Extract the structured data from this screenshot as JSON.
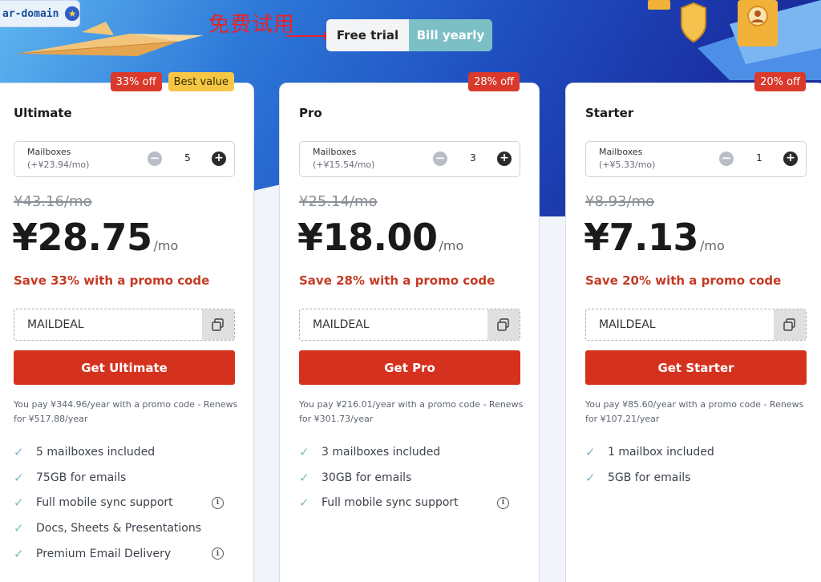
{
  "header": {
    "domain_chip_text": "ar-domain",
    "annotation_text": "免费试用",
    "toggle": {
      "free_trial_label": "Free trial",
      "bill_yearly_label": "Bill yearly"
    }
  },
  "colors": {
    "cta_red": "#d4321f",
    "save_red": "#c43a24",
    "badge_red": "#d93a2b",
    "badge_yellow": "#f6c744",
    "toggle_teal": "#7cc0c6",
    "check_teal": "#7ab8bf"
  },
  "plans": [
    {
      "name": "Ultimate",
      "badges": [
        "33% off",
        "Best value"
      ],
      "mailboxes_label": "Mailboxes",
      "mailbox_price": "(+¥23.94/mo)",
      "quantity": "5",
      "old_price": "¥43.16/mo",
      "price": "¥28.75",
      "period": "/mo",
      "save_text": "Save 33% with a promo code",
      "promo_code": "MAILDEAL",
      "cta_label": "Get Ultimate",
      "pay_note": "You pay ¥344.96/year with a promo code - Renews for ¥517.88/year",
      "features": [
        {
          "text": "5 mailboxes included",
          "info": false
        },
        {
          "text": "75GB for emails",
          "info": false
        },
        {
          "text": "Full mobile sync support",
          "info": true
        },
        {
          "text": "Docs, Sheets & Presentations",
          "info": false
        },
        {
          "text": "Premium Email Delivery",
          "info": true
        }
      ]
    },
    {
      "name": "Pro",
      "badges": [
        "28% off"
      ],
      "mailboxes_label": "Mailboxes",
      "mailbox_price": "(+¥15.54/mo)",
      "quantity": "3",
      "old_price": "¥25.14/mo",
      "price": "¥18.00",
      "period": "/mo",
      "save_text": "Save 28% with a promo code",
      "promo_code": "MAILDEAL",
      "cta_label": "Get Pro",
      "pay_note": "You pay ¥216.01/year with a promo code - Renews for ¥301.73/year",
      "features": [
        {
          "text": "3 mailboxes included",
          "info": false
        },
        {
          "text": "30GB for emails",
          "info": false
        },
        {
          "text": "Full mobile sync support",
          "info": true
        }
      ]
    },
    {
      "name": "Starter",
      "badges": [
        "20% off"
      ],
      "mailboxes_label": "Mailboxes",
      "mailbox_price": "(+¥5.33/mo)",
      "quantity": "1",
      "old_price": "¥8.93/mo",
      "price": "¥7.13",
      "period": "/mo",
      "save_text": "Save 20% with a promo code",
      "promo_code": "MAILDEAL",
      "cta_label": "Get Starter",
      "pay_note": "You pay ¥85.60/year with a promo code - Renews for ¥107.21/year",
      "features": [
        {
          "text": "1 mailbox included",
          "info": false
        },
        {
          "text": "5GB for emails",
          "info": false
        }
      ]
    }
  ]
}
